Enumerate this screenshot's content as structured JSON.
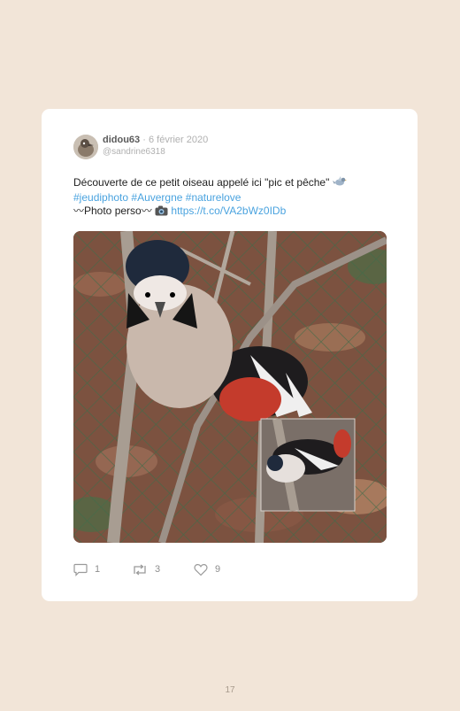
{
  "tweet": {
    "display_name": "didou63",
    "separator": "·",
    "date": "6 février 2020",
    "username": "@sandrine6318",
    "text_line1": "Découverte de ce petit oiseau appelé ici \"pic et pêche\"",
    "emoji1": "bird-emoji",
    "hashtags": "#jeudiphoto #Auvergne #naturelove",
    "text_line3_prefix": "〰Photo perso〰",
    "emoji2": "camera-emoji",
    "link": "https://t.co/VA2bWz0IDb"
  },
  "actions": {
    "replies": "1",
    "retweets": "3",
    "likes": "9"
  },
  "page_number": "17",
  "icons": [
    "reply-icon",
    "retweet-icon",
    "heart-icon"
  ],
  "colors": {
    "background": "#f2e5d8",
    "card": "#ffffff",
    "link": "#4aa3df",
    "muted": "#b0b0b0"
  }
}
